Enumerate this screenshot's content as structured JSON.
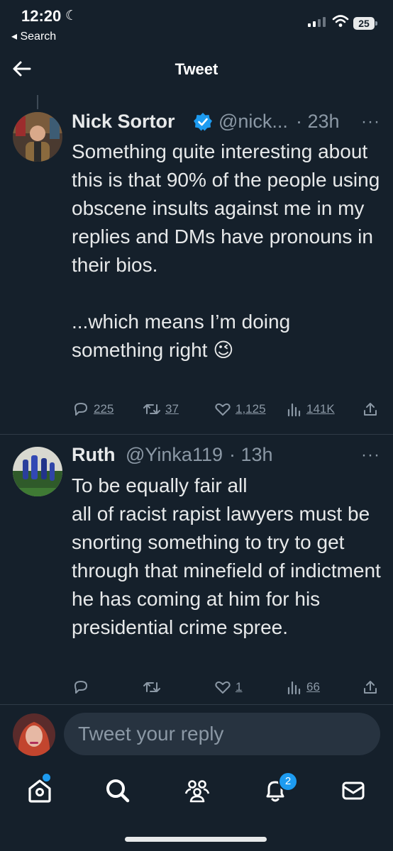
{
  "status_bar": {
    "time": "12:20",
    "back_app": "◂ Search",
    "battery": "25"
  },
  "header": {
    "title": "Tweet"
  },
  "tweets": [
    {
      "name": "Nick Sortor",
      "verified": true,
      "handle": "@nick...",
      "time": "· 23h",
      "text": "Something quite interesting about this is that 90% of the people using obscene insults against me in my replies and DMs have pronouns in their bios.\n\n...which means I’m doing something right 😉",
      "stats": {
        "replies": "225",
        "retweets": "37",
        "likes": "1,125",
        "views": "141K"
      }
    },
    {
      "name": "Ruth",
      "handle": "@Yinka119",
      "time": "· 13h",
      "text": "To be equally fair all\nall of  racist rapist lawyers must be snorting something to try to get through that minefield of indictment he has coming at him for his presidential crime spree.",
      "stats": {
        "replies": "",
        "retweets": "",
        "likes": "1",
        "views": "66"
      }
    }
  ],
  "reply_bar": {
    "placeholder": "Tweet your reply"
  },
  "bottom_nav": {
    "notifications_badge": "2"
  },
  "colors": {
    "background": "#15202b",
    "accent": "#1d9bf0",
    "muted": "#8b98a5",
    "text": "#e7e9ea"
  },
  "icons": [
    "back-arrow-icon",
    "verified-badge-icon",
    "more-icon",
    "reply-icon",
    "retweet-icon",
    "like-icon",
    "views-icon",
    "share-icon",
    "home-icon",
    "search-icon",
    "communities-icon",
    "notifications-icon",
    "messages-icon"
  ]
}
